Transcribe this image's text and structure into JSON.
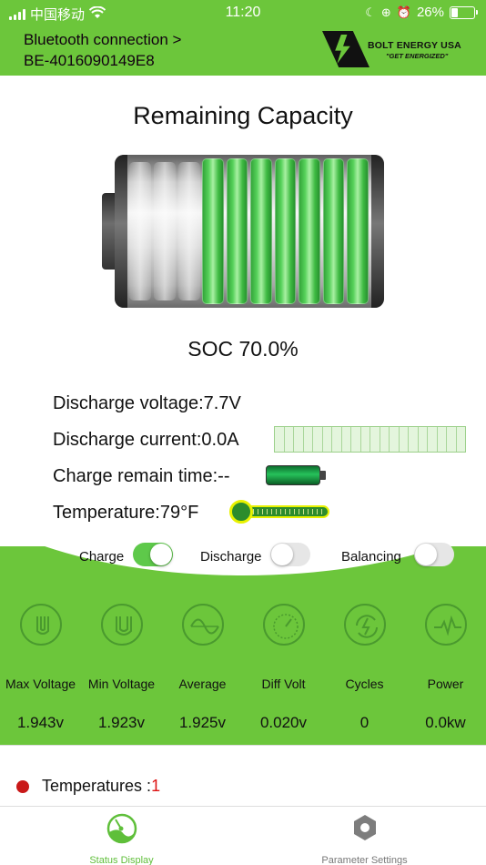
{
  "status_bar": {
    "carrier": "中国移动",
    "time": "11:20",
    "battery": "26%",
    "battery_level": 0.26
  },
  "header": {
    "connection_line1": "Bluetooth connection >",
    "connection_line2": "BE-4016090149E8",
    "brand": "BOLT ENERGY USA",
    "slogan": "\"GET ENERGIZED\""
  },
  "main": {
    "title": "Remaining Capacity",
    "soc": "SOC 70.0%",
    "soc_level": 0.7,
    "discharge_voltage": "Discharge voltage:7.7V",
    "discharge_current": "Discharge current:0.0A",
    "charge_remain": "Charge remain time:--",
    "temperature": "Temperature:79°F"
  },
  "toggles": {
    "charge": {
      "label": "Charge",
      "on": true
    },
    "discharge": {
      "label": "Discharge",
      "on": false
    },
    "balancing": {
      "label": "Balancing",
      "on": false
    }
  },
  "stats": [
    {
      "label": "Max Voltage",
      "value": "1.943v",
      "icon": "max-voltage-icon"
    },
    {
      "label": "Min Voltage",
      "value": "1.923v",
      "icon": "min-voltage-icon"
    },
    {
      "label": "Average",
      "value": "1.925v",
      "icon": "average-icon"
    },
    {
      "label": "Diff Volt",
      "value": "0.020v",
      "icon": "gauge-icon"
    },
    {
      "label": "Cycles",
      "value": "0",
      "icon": "cycle-icon"
    },
    {
      "label": "Power",
      "value": "0.0kw",
      "icon": "power-icon"
    }
  ],
  "temperatures": {
    "label": "Temperatures :",
    "count": "1"
  },
  "tabs": {
    "status": "Status Display",
    "params": "Parameter Settings"
  },
  "colors": {
    "accent": "#6cc63b",
    "alert": "#c91919"
  }
}
